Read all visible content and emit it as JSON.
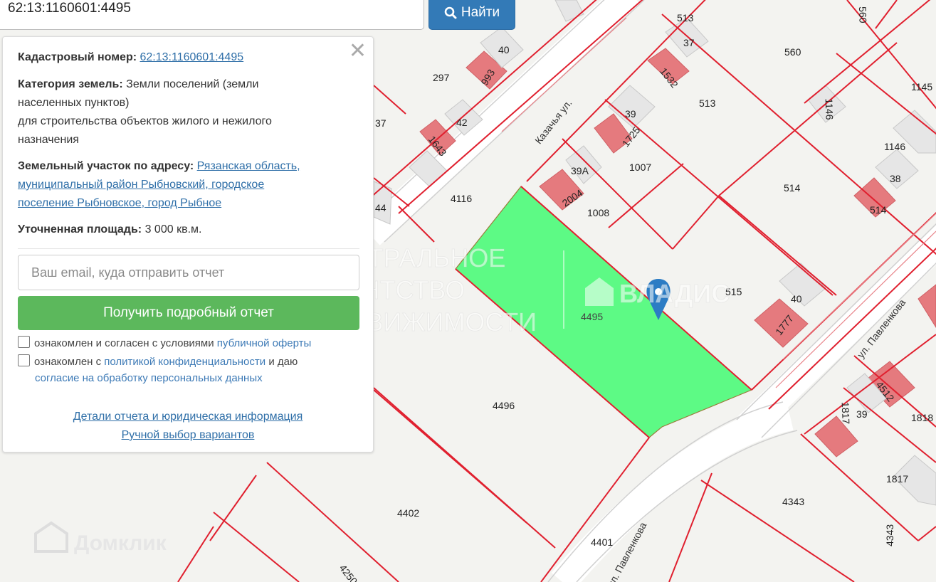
{
  "search": {
    "value": "62:13:1160601:4495",
    "button_label": "Найти"
  },
  "panel": {
    "cadastral_label": "Кадастровый номер:",
    "cadastral_value": "62:13:1160601:4495",
    "category_label": "Категория земель:",
    "category_value_1": "Земли поселений (земли",
    "category_value_2": "населенных пунктов)",
    "category_value_3": "для строительства объектов жилого и нежилого",
    "category_value_4": "назначения",
    "address_label": "Земельный участок по адресу:",
    "address_line_1": "Рязанская область,",
    "address_line_2": "муниципальный район Рыбновский, городское",
    "address_line_3": "поселение Рыбновское, город Рыбное",
    "area_label": "Уточненная площадь:",
    "area_value": "3 000 кв.м.",
    "email_placeholder": "Ваш email, куда отправить отчет",
    "report_button": "Получить подробный отчет",
    "consent_1_text": "ознакомлен и согласен с условиями",
    "consent_1_link": "публичной оферты",
    "consent_2_text": "ознакомлен с",
    "consent_2_link": "политикой конфиденциальности",
    "consent_2_tail": "и даю",
    "consent_2_link2": "согласие на обработку персональных данных",
    "details_link": "Детали отчета и юридическая информация",
    "manual_link": "Ручной выбор вариантов"
  },
  "map": {
    "parcel_labels": [
      "513",
      "37",
      "560",
      "40",
      "297",
      "993",
      "1532",
      "513",
      "1146",
      "1145",
      "42",
      "1643",
      "39",
      "1725",
      "1146",
      "1007",
      "39А",
      "2004",
      "514",
      "38",
      "514",
      "4116",
      "1008",
      "4495",
      "515",
      "40",
      "1777",
      "4512",
      "1817",
      "39",
      "1818",
      "4496",
      "1817",
      "4402",
      "4343",
      "4401",
      "4343",
      "4250",
      "560",
      "37",
      "44"
    ],
    "street_labels": [
      "Казачья ул.",
      "ул. Павленкова",
      "ул. Павленкова"
    ],
    "watermarks": [
      "ЦЕНТРАЛЬНОЕ",
      "АГЕНТСТВО",
      "НЕДВИЖИМОСТИ",
      "ВЛАДИС",
      "Домклик"
    ],
    "colors": {
      "selected_parcel": "#5dfa85",
      "boundary": "#e0202f",
      "building": "#e57a7e",
      "road": "#ffffff"
    }
  }
}
